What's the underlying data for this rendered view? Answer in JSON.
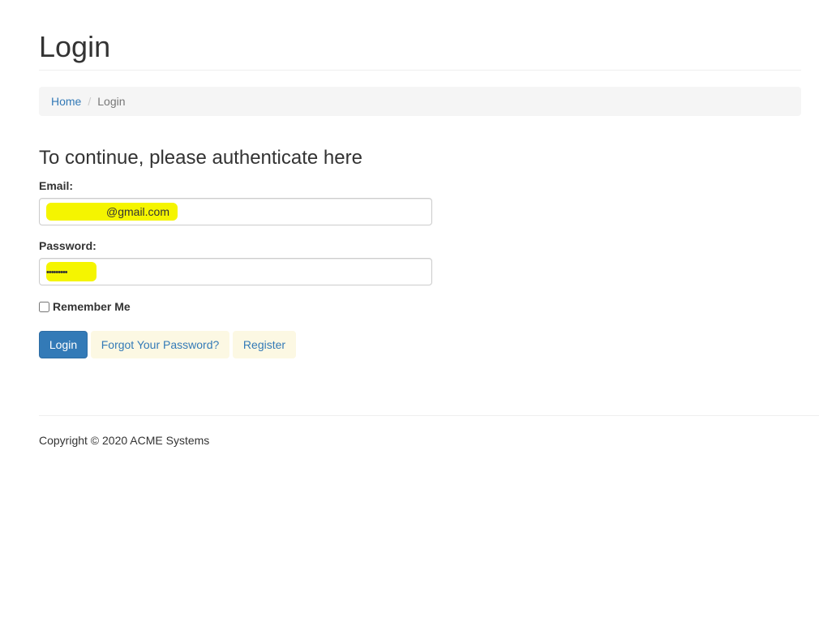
{
  "page": {
    "title": "Login"
  },
  "breadcrumb": {
    "home": "Home",
    "separator": "/",
    "current": "Login"
  },
  "form": {
    "heading": "To continue, please authenticate here",
    "email_label": "Email:",
    "email_value": "@gmail.com",
    "password_label": "Password:",
    "password_value": "•••••••••",
    "remember_label": "Remember Me",
    "remember_checked": false
  },
  "buttons": {
    "login": "Login",
    "forgot": "Forgot Your Password?",
    "register": "Register"
  },
  "footer": {
    "copyright": "Copyright © 2020 ACME Systems"
  },
  "colors": {
    "primary": "#337ab7",
    "highlight": "#f5f500",
    "link_button_bg": "#fcf8e3"
  }
}
